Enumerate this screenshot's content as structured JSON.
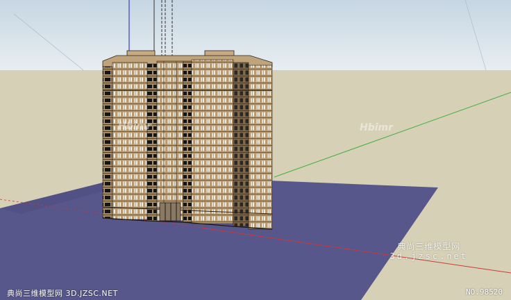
{
  "watermark": {
    "line1": "典尚三维模型网",
    "line2": "3d.jzsc.net",
    "faint_logo": "Hbimr"
  },
  "footer": {
    "left_text": "典尚三维模型网 3D.JZSC.NET",
    "right_text": "NO.98520"
  },
  "scene": {
    "sky_color": "#d7e3ec",
    "ground_color": "#d6d1b6",
    "base_plane_color": "#57578c",
    "facade_color": "#b99b73",
    "green_axis_color": "#3fae3f",
    "red_axis_color": "#c83a3a",
    "blue_axis_color": "#3b3bd0"
  }
}
